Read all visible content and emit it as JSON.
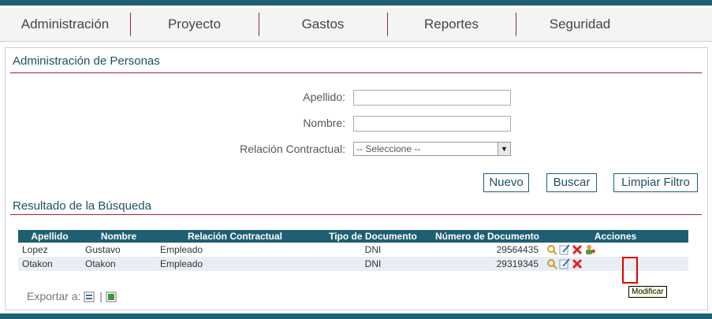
{
  "nav": {
    "items": [
      "Administración",
      "Proyecto",
      "Gastos",
      "Reportes",
      "Seguridad"
    ]
  },
  "page_title": "Administración de Personas",
  "form": {
    "apellido_label": "Apellido:",
    "apellido_value": "",
    "nombre_label": "Nombre:",
    "nombre_value": "",
    "relacion_label": "Relación Contractual:",
    "relacion_value": "-- Seleccione --"
  },
  "buttons": {
    "nuevo": "Nuevo",
    "buscar": "Buscar",
    "limpiar": "Limpiar Filtro"
  },
  "results_title": "Resultado de la Búsqueda",
  "table": {
    "headers": [
      "Apellido",
      "Nombre",
      "Relación Contractual",
      "Tipo de Documento",
      "Número de Documento",
      "Acciones"
    ],
    "rows": [
      [
        "Lopez",
        "Gustavo",
        "Empleado",
        "DNI",
        "29564435"
      ],
      [
        "Otakon",
        "Otakon",
        "Empleado",
        "DNI",
        "29319345"
      ]
    ]
  },
  "export_label": "Exportar a:",
  "export_sep": "|",
  "tooltip": "Modificar",
  "colors": {
    "primary": "#1f5f74",
    "accent": "#a31e3a"
  }
}
